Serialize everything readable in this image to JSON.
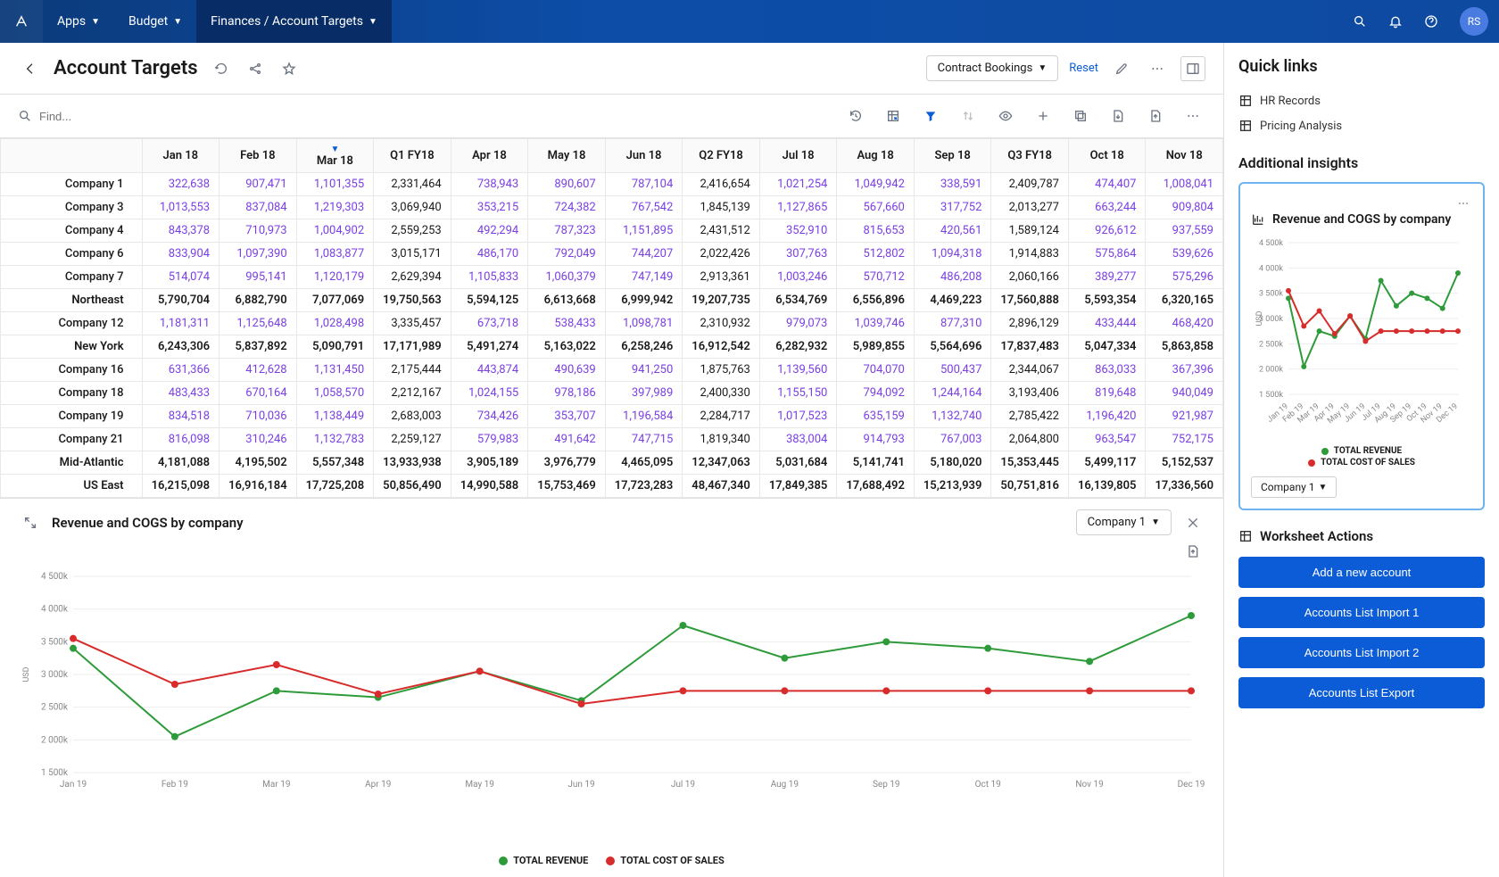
{
  "nav": {
    "apps_label": "Apps",
    "budget_label": "Budget",
    "breadcrumb": "Finances / Account Targets",
    "avatar_initials": "RS"
  },
  "header": {
    "back_aria": "Back",
    "title": "Account Targets",
    "dropdown_label": "Contract Bookings",
    "reset_label": "Reset"
  },
  "search": {
    "placeholder": "Find..."
  },
  "grid": {
    "columns": [
      "Jan 18",
      "Feb 18",
      "Mar 18",
      "Q1 FY18",
      "Apr 18",
      "May 18",
      "Jun 18",
      "Q2 FY18",
      "Jul 18",
      "Aug 18",
      "Sep 18",
      "Q3 FY18",
      "Oct 18",
      "Nov 18"
    ],
    "filter_col_index": 2,
    "rows": [
      {
        "label": "Company 1",
        "indent": 1,
        "link": true,
        "values": [
          "322,638",
          "907,471",
          "1,101,355",
          "2,331,464",
          "738,943",
          "890,607",
          "787,104",
          "2,416,654",
          "1,021,254",
          "1,049,942",
          "338,591",
          "2,409,787",
          "474,407",
          "1,008,041"
        ],
        "linkcols": [
          0,
          1,
          2,
          4,
          5,
          6,
          8,
          9,
          10,
          12,
          13
        ]
      },
      {
        "label": "Company 3",
        "indent": 1,
        "link": true,
        "values": [
          "1,013,553",
          "837,084",
          "1,219,303",
          "3,069,940",
          "353,215",
          "724,382",
          "767,542",
          "1,845,139",
          "1,127,865",
          "567,660",
          "317,752",
          "2,013,277",
          "663,244",
          "909,804"
        ],
        "linkcols": [
          0,
          1,
          2,
          4,
          5,
          6,
          8,
          9,
          10,
          12,
          13
        ]
      },
      {
        "label": "Company 4",
        "indent": 1,
        "link": true,
        "values": [
          "843,378",
          "710,973",
          "1,004,902",
          "2,559,253",
          "492,294",
          "787,323",
          "1,151,895",
          "2,431,512",
          "352,910",
          "815,653",
          "420,561",
          "1,589,124",
          "926,612",
          "937,559"
        ],
        "linkcols": [
          0,
          1,
          2,
          4,
          5,
          6,
          8,
          9,
          10,
          12,
          13
        ]
      },
      {
        "label": "Company 6",
        "indent": 1,
        "link": true,
        "values": [
          "833,904",
          "1,097,390",
          "1,083,877",
          "3,015,171",
          "486,170",
          "792,049",
          "744,207",
          "2,022,426",
          "307,763",
          "512,802",
          "1,094,318",
          "1,914,883",
          "575,864",
          "539,626"
        ],
        "linkcols": [
          0,
          1,
          2,
          4,
          5,
          6,
          8,
          9,
          10,
          12,
          13
        ]
      },
      {
        "label": "Company 7",
        "indent": 1,
        "link": true,
        "values": [
          "514,074",
          "995,141",
          "1,120,179",
          "2,629,394",
          "1,105,833",
          "1,060,379",
          "747,149",
          "2,913,361",
          "1,003,246",
          "570,712",
          "486,208",
          "2,060,166",
          "389,277",
          "575,296"
        ],
        "linkcols": [
          0,
          1,
          2,
          4,
          5,
          6,
          8,
          9,
          10,
          12,
          13
        ]
      },
      {
        "label": "Northeast",
        "indent": 0,
        "bold": true,
        "values": [
          "5,790,704",
          "6,882,790",
          "7,077,069",
          "19,750,563",
          "5,594,125",
          "6,613,668",
          "6,999,942",
          "19,207,735",
          "6,534,769",
          "6,556,896",
          "4,469,223",
          "17,560,888",
          "5,593,354",
          "6,320,165"
        ]
      },
      {
        "label": "Company 12",
        "indent": 1,
        "link": true,
        "values": [
          "1,181,311",
          "1,125,648",
          "1,028,498",
          "3,335,457",
          "673,718",
          "538,433",
          "1,098,781",
          "2,310,932",
          "979,073",
          "1,039,746",
          "877,310",
          "2,896,129",
          "433,444",
          "468,420"
        ],
        "linkcols": [
          0,
          1,
          2,
          4,
          5,
          6,
          8,
          9,
          10,
          12,
          13
        ]
      },
      {
        "label": "New York",
        "indent": 0,
        "bold": true,
        "values": [
          "6,243,306",
          "5,837,892",
          "5,090,791",
          "17,171,989",
          "5,491,274",
          "5,163,022",
          "6,258,246",
          "16,912,542",
          "6,282,932",
          "5,989,855",
          "5,564,696",
          "17,837,483",
          "5,047,334",
          "5,863,858"
        ]
      },
      {
        "label": "Company 16",
        "indent": 1,
        "link": true,
        "values": [
          "631,366",
          "412,628",
          "1,131,450",
          "2,175,444",
          "443,874",
          "490,639",
          "941,250",
          "1,875,763",
          "1,139,560",
          "704,070",
          "500,437",
          "2,344,067",
          "863,033",
          "367,396"
        ],
        "linkcols": [
          0,
          1,
          2,
          4,
          5,
          6,
          8,
          9,
          10,
          12,
          13
        ]
      },
      {
        "label": "Company 18",
        "indent": 1,
        "link": true,
        "values": [
          "483,433",
          "670,164",
          "1,058,570",
          "2,212,167",
          "1,024,155",
          "978,186",
          "397,989",
          "2,400,330",
          "1,155,150",
          "794,092",
          "1,244,164",
          "3,193,406",
          "819,648",
          "940,049"
        ],
        "linkcols": [
          0,
          1,
          2,
          4,
          5,
          6,
          8,
          9,
          10,
          12,
          13
        ]
      },
      {
        "label": "Company 19",
        "indent": 1,
        "link": true,
        "values": [
          "834,518",
          "710,036",
          "1,138,449",
          "2,683,003",
          "734,426",
          "353,707",
          "1,196,584",
          "2,284,717",
          "1,017,523",
          "635,159",
          "1,132,740",
          "2,785,422",
          "1,196,420",
          "921,987"
        ],
        "linkcols": [
          0,
          1,
          2,
          4,
          5,
          6,
          8,
          9,
          10,
          12,
          13
        ]
      },
      {
        "label": "Company 21",
        "indent": 1,
        "link": true,
        "values": [
          "816,098",
          "310,246",
          "1,132,783",
          "2,259,127",
          "579,983",
          "491,642",
          "747,715",
          "1,819,340",
          "383,004",
          "914,793",
          "767,003",
          "2,064,800",
          "963,547",
          "752,175"
        ],
        "linkcols": [
          0,
          1,
          2,
          4,
          5,
          6,
          8,
          9,
          10,
          12,
          13
        ]
      },
      {
        "label": "Mid-Atlantic",
        "indent": 0,
        "bold": true,
        "values": [
          "4,181,088",
          "4,195,502",
          "5,557,348",
          "13,933,938",
          "3,905,189",
          "3,976,779",
          "4,465,095",
          "12,347,063",
          "5,031,684",
          "5,141,741",
          "5,180,020",
          "15,353,445",
          "5,499,117",
          "5,152,537"
        ]
      },
      {
        "label": "US East",
        "indent": 0,
        "bold": true,
        "values": [
          "16,215,098",
          "16,916,184",
          "17,725,208",
          "50,856,490",
          "14,990,588",
          "15,753,469",
          "17,723,283",
          "48,467,340",
          "17,849,385",
          "17,688,492",
          "15,213,939",
          "50,751,816",
          "16,139,805",
          "17,336,560"
        ]
      }
    ]
  },
  "chart": {
    "title": "Revenue and COGS by company",
    "selector": "Company 1",
    "yaxis_label": "USD",
    "legend": {
      "revenue": "TOTAL REVENUE",
      "cogs": "TOTAL COST OF SALES"
    },
    "colors": {
      "revenue": "#2e9b3a",
      "cogs": "#d82b2b"
    }
  },
  "chart_data": {
    "type": "line",
    "xlabel": "",
    "ylabel": "USD",
    "ylim": [
      1500000,
      4500000
    ],
    "yticks": [
      "1 500k",
      "2 000k",
      "2 500k",
      "3 000k",
      "3 500k",
      "4 000k",
      "4 500k"
    ],
    "categories": [
      "Jan 19",
      "Feb 19",
      "Mar 19",
      "Apr 19",
      "May 19",
      "Jun 19",
      "Jul 19",
      "Aug 19",
      "Sep 19",
      "Oct 19",
      "Nov 19",
      "Dec 19"
    ],
    "series": [
      {
        "name": "TOTAL REVENUE",
        "color": "#2e9b3a",
        "values": [
          3400000,
          2050000,
          2750000,
          2650000,
          3050000,
          2600000,
          3750000,
          3250000,
          3500000,
          3400000,
          3200000,
          3900000
        ]
      },
      {
        "name": "TOTAL COST OF SALES",
        "color": "#d82b2b",
        "values": [
          3550000,
          2850000,
          3150000,
          2700000,
          3050000,
          2550000,
          2750000,
          2750000,
          2750000,
          2750000,
          2750000,
          2750000
        ]
      }
    ]
  },
  "right": {
    "quick_links_title": "Quick links",
    "links": [
      {
        "label": "HR Records"
      },
      {
        "label": "Pricing Analysis"
      }
    ],
    "insights_title": "Additional insights",
    "insight_card_title": "Revenue and COGS by company",
    "insight_selector": "Company 1",
    "worksheet_title": "Worksheet Actions",
    "actions": [
      {
        "label": "Add a new account"
      },
      {
        "label": "Accounts List Import 1"
      },
      {
        "label": "Accounts List Import 2"
      },
      {
        "label": "Accounts List Export"
      }
    ]
  },
  "mini_chart_data": {
    "type": "line",
    "ylim": [
      1500000,
      4500000
    ],
    "yticks": [
      "1 500k",
      "2 000k",
      "2 500k",
      "3 000k",
      "3 500k",
      "4 000k",
      "4 500k"
    ],
    "categories": [
      "Jan 19",
      "Mar 19",
      "May 19",
      "Jul 19",
      "Sep 19",
      "Nov 19"
    ],
    "series": [
      {
        "name": "TOTAL REVENUE",
        "color": "#2e9b3a",
        "values": [
          3400000,
          2750000,
          3050000,
          3750000,
          3500000,
          3200000
        ]
      },
      {
        "name": "TOTAL COST OF SALES",
        "color": "#d82b2b",
        "values": [
          3550000,
          3150000,
          3050000,
          2750000,
          2750000,
          2750000
        ]
      }
    ]
  }
}
